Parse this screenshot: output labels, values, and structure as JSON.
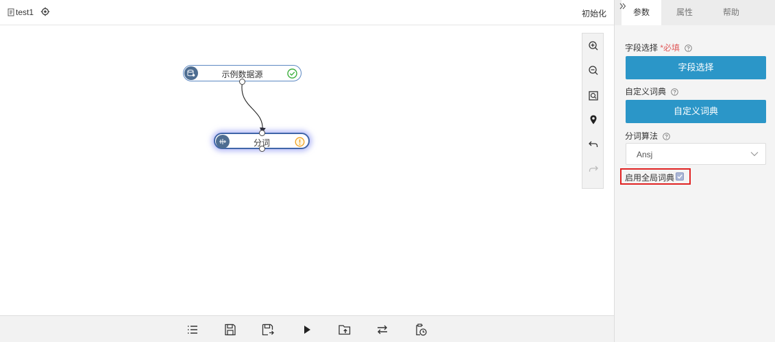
{
  "header": {
    "flow_name": "test1",
    "init_label": "初始化"
  },
  "canvas": {
    "nodes": [
      {
        "label": "示例数据源",
        "status": "success"
      },
      {
        "label": "分词",
        "status": "warning"
      }
    ],
    "zoom_toolbar": {
      "buttons": [
        "zoom-in",
        "zoom-out",
        "fit-view",
        "locate",
        "undo",
        "redo"
      ]
    }
  },
  "bottom_toolbar": {
    "buttons": [
      "list",
      "save",
      "save-as",
      "run",
      "import",
      "switch",
      "schedule"
    ]
  },
  "panel": {
    "tabs": [
      {
        "label": "参数",
        "active": true
      },
      {
        "label": "属性",
        "active": false
      },
      {
        "label": "帮助",
        "active": false
      }
    ],
    "field_select": {
      "label": "字段选择",
      "required": "*必填",
      "button": "字段选择"
    },
    "custom_dict": {
      "label": "自定义词典",
      "button": "自定义词典"
    },
    "algorithm": {
      "label": "分词算法",
      "value": "Ansj"
    },
    "global_dict": {
      "label": "启用全局词典",
      "checked": true
    }
  },
  "colors": {
    "primary": "#2b96c8",
    "node_border": "#5b87c2",
    "success": "#3cae3c",
    "warning": "#f0a020",
    "highlight": "#e02222"
  }
}
